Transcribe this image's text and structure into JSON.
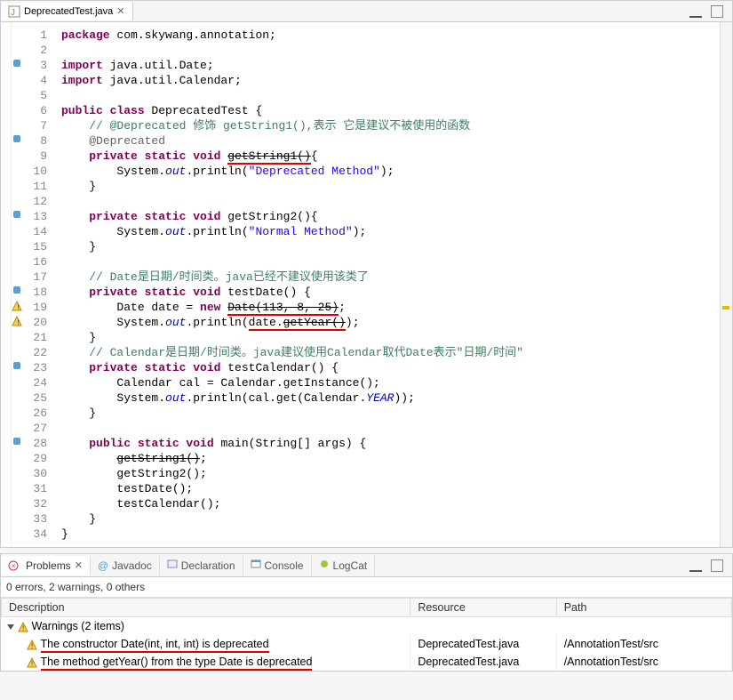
{
  "editor": {
    "tab": {
      "filename": "DeprecatedTest.java"
    }
  },
  "code": {
    "lines": [
      {
        "n": 1,
        "tokens": [
          {
            "t": "package ",
            "c": "kw"
          },
          {
            "t": "com.skywang.annotation;"
          }
        ]
      },
      {
        "n": 2,
        "tokens": []
      },
      {
        "n": 3,
        "marker": "blue",
        "tokens": [
          {
            "t": "import ",
            "c": "kw"
          },
          {
            "t": "java.util.Date;"
          }
        ]
      },
      {
        "n": 4,
        "tokens": [
          {
            "t": "import ",
            "c": "kw"
          },
          {
            "t": "java.util.Calendar;"
          }
        ]
      },
      {
        "n": 5,
        "tokens": []
      },
      {
        "n": 6,
        "tokens": [
          {
            "t": "public class ",
            "c": "kw"
          },
          {
            "t": "DeprecatedTest {"
          }
        ]
      },
      {
        "n": 7,
        "tokens": [
          {
            "t": "    "
          },
          {
            "t": "// @Deprecated 修饰 getString1(),表示 它是建议不被使用的函数",
            "c": "cmt"
          }
        ]
      },
      {
        "n": 8,
        "marker": "blue",
        "tokens": [
          {
            "t": "    "
          },
          {
            "t": "@Deprecated",
            "c": "ann"
          }
        ]
      },
      {
        "n": 9,
        "tokens": [
          {
            "t": "    "
          },
          {
            "t": "private static void ",
            "c": "kw"
          },
          {
            "t": "getString1()",
            "c": "strike squiggle"
          },
          {
            "t": "{"
          }
        ]
      },
      {
        "n": 10,
        "tokens": [
          {
            "t": "        System."
          },
          {
            "t": "out",
            "c": "fld"
          },
          {
            "t": ".println("
          },
          {
            "t": "\"Deprecated Method\"",
            "c": "str"
          },
          {
            "t": ");"
          }
        ]
      },
      {
        "n": 11,
        "tokens": [
          {
            "t": "    }"
          }
        ]
      },
      {
        "n": 12,
        "tokens": []
      },
      {
        "n": 13,
        "marker": "blue",
        "tokens": [
          {
            "t": "    "
          },
          {
            "t": "private static void ",
            "c": "kw"
          },
          {
            "t": "getString2(){"
          }
        ]
      },
      {
        "n": 14,
        "tokens": [
          {
            "t": "        System."
          },
          {
            "t": "out",
            "c": "fld"
          },
          {
            "t": ".println("
          },
          {
            "t": "\"Normal Method\"",
            "c": "str"
          },
          {
            "t": ");"
          }
        ]
      },
      {
        "n": 15,
        "tokens": [
          {
            "t": "    }"
          }
        ]
      },
      {
        "n": 16,
        "tokens": []
      },
      {
        "n": 17,
        "tokens": [
          {
            "t": "    "
          },
          {
            "t": "// Date是日期/时间类。java已经不建议使用该类了",
            "c": "cmt"
          }
        ]
      },
      {
        "n": 18,
        "marker": "blue",
        "tokens": [
          {
            "t": "    "
          },
          {
            "t": "private static void ",
            "c": "kw"
          },
          {
            "t": "testDate() {"
          }
        ]
      },
      {
        "n": 19,
        "marker": "warn",
        "tokens": [
          {
            "t": "        Date date = "
          },
          {
            "t": "new ",
            "c": "kw"
          },
          {
            "t": "Date(113, 8, 25)",
            "c": "strike squiggle"
          },
          {
            "t": ";"
          }
        ]
      },
      {
        "n": 20,
        "marker": "warn",
        "tokens": [
          {
            "t": "        System."
          },
          {
            "t": "out",
            "c": "fld"
          },
          {
            "t": ".println("
          },
          {
            "t": "date.",
            "c": "squiggle"
          },
          {
            "t": "getYear()",
            "c": "strike squiggle"
          },
          {
            "t": ");"
          }
        ]
      },
      {
        "n": 21,
        "tokens": [
          {
            "t": "    }"
          }
        ]
      },
      {
        "n": 22,
        "tokens": [
          {
            "t": "    "
          },
          {
            "t": "// Calendar是日期/时间类。java建议使用Calendar取代Date表示\"日期/时间\"",
            "c": "cmt"
          }
        ]
      },
      {
        "n": 23,
        "marker": "blue",
        "tokens": [
          {
            "t": "    "
          },
          {
            "t": "private static void ",
            "c": "kw"
          },
          {
            "t": "testCalendar() {"
          }
        ]
      },
      {
        "n": 24,
        "tokens": [
          {
            "t": "        Calendar cal = Calendar.getInstance();"
          }
        ]
      },
      {
        "n": 25,
        "tokens": [
          {
            "t": "        System."
          },
          {
            "t": "out",
            "c": "fld"
          },
          {
            "t": ".println(cal.get(Calendar."
          },
          {
            "t": "YEAR",
            "c": "fld"
          },
          {
            "t": "));"
          }
        ]
      },
      {
        "n": 26,
        "tokens": [
          {
            "t": "    }"
          }
        ]
      },
      {
        "n": 27,
        "tokens": []
      },
      {
        "n": 28,
        "marker": "blue",
        "tokens": [
          {
            "t": "    "
          },
          {
            "t": "public static void ",
            "c": "kw"
          },
          {
            "t": "main(String[] args) {"
          }
        ]
      },
      {
        "n": 29,
        "tokens": [
          {
            "t": "        "
          },
          {
            "t": "getString1()",
            "c": "strike"
          },
          {
            "t": ";"
          }
        ]
      },
      {
        "n": 30,
        "tokens": [
          {
            "t": "        "
          },
          {
            "t": "getString2();",
            "c": ""
          }
        ]
      },
      {
        "n": 31,
        "tokens": [
          {
            "t": "        "
          },
          {
            "t": "testDate();",
            "c": ""
          }
        ]
      },
      {
        "n": 32,
        "tokens": [
          {
            "t": "        "
          },
          {
            "t": "testCalendar();",
            "c": ""
          }
        ]
      },
      {
        "n": 33,
        "tokens": [
          {
            "t": "    }"
          }
        ]
      },
      {
        "n": 34,
        "tokens": [
          {
            "t": "}"
          }
        ]
      }
    ]
  },
  "problems": {
    "tabs": [
      "Problems",
      "Javadoc",
      "Declaration",
      "Console",
      "LogCat"
    ],
    "status": "0 errors, 2 warnings, 0 others",
    "columns": [
      "Description",
      "Resource",
      "Path"
    ],
    "groupLabel": "Warnings (2 items)",
    "items": [
      {
        "description": "The constructor Date(int, int, int) is deprecated",
        "resource": "DeprecatedTest.java",
        "path": "/AnnotationTest/src"
      },
      {
        "description": "The method getYear() from the type Date is deprecated",
        "resource": "DeprecatedTest.java",
        "path": "/AnnotationTest/src"
      }
    ]
  }
}
